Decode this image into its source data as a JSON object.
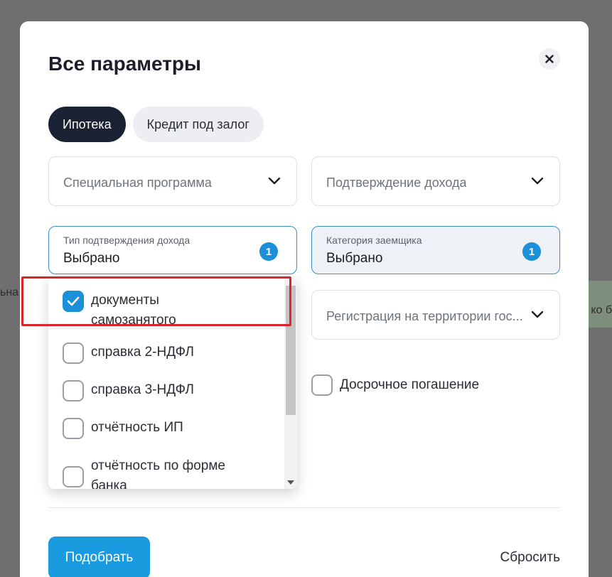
{
  "background": {
    "left_text": "ьна",
    "right_text": "ко б"
  },
  "modal": {
    "title": "Все параметры",
    "close_icon": "close-icon"
  },
  "tabs": [
    {
      "label": "Ипотека",
      "active": true
    },
    {
      "label": "Кредит под залог",
      "active": false
    }
  ],
  "fields": {
    "special_program": {
      "placeholder": "Специальная программа"
    },
    "income_confirmation": {
      "placeholder": "Подтверждение дохода"
    },
    "income_confirmation_type": {
      "label": "Тип подтверждения дохода",
      "value": "Выбрано",
      "count": "1"
    },
    "borrower_category": {
      "label": "Категория заемщика",
      "value": "Выбрано",
      "count": "1"
    },
    "registration": {
      "placeholder": "Регистрация на территории гос..."
    }
  },
  "dropdown": {
    "items": [
      {
        "label": "документы самозанятого",
        "checked": true
      },
      {
        "label": "справка 2-НДФЛ",
        "checked": false
      },
      {
        "label": "справка 3-НДФЛ",
        "checked": false
      },
      {
        "label": "отчётность ИП",
        "checked": false
      },
      {
        "label": "отчётность по форме банка",
        "checked": false
      }
    ]
  },
  "early_repayment": {
    "label": "Досрочное погашение",
    "checked": false
  },
  "actions": {
    "submit_label": "Подобрать",
    "reset_label": "Сбросить"
  },
  "colors": {
    "accent": "#1b8fd8",
    "highlight": "#d7272b",
    "active_tab": "#1a2233"
  }
}
